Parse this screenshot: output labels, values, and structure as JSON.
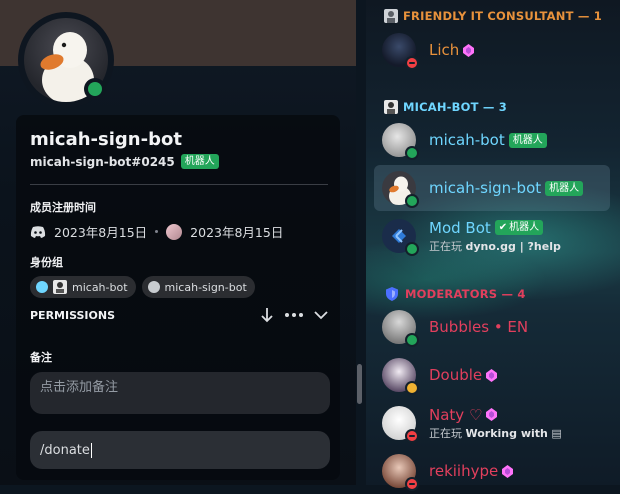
{
  "profile": {
    "display_name": "micah-sign-bot",
    "tag": "micah-sign-bot#0245",
    "bot_badge": "机器人",
    "member_since_title": "成员注册时间",
    "discord_joined": "2023年8月15日",
    "server_joined": "2023年8月15日",
    "roles_title": "身份组",
    "roles": [
      {
        "label": "micah-bot",
        "color": "#6fd6ff"
      },
      {
        "label": "micah-sign-bot",
        "color": "#c8ccd0"
      }
    ],
    "permissions_title": "PERMISSIONS",
    "note_title": "备注",
    "note_placeholder": "点击添加备注",
    "message_value": "/donate"
  },
  "member_list": {
    "groups": [
      {
        "title": "FRIENDLY IT CONSULTANT — 1",
        "color": "#e8923c",
        "members": [
          {
            "name": "Lich",
            "name_color": "#e8923c",
            "status": "dnd",
            "boost": true
          }
        ]
      },
      {
        "title": "MICAH-BOT — 3",
        "color": "#6fd6ff",
        "members": [
          {
            "name": "micah-bot",
            "name_color": "#6fd6ff",
            "status": "online",
            "badge": "机器人"
          },
          {
            "name": "micah-sign-bot",
            "name_color": "#6fd6ff",
            "status": "online",
            "badge": "机器人",
            "selected": true
          },
          {
            "name": "Mod Bot",
            "name_color": "#6fd6ff",
            "status": "online",
            "badge": "机器人",
            "verified": true,
            "activity_prefix": "正在玩",
            "activity": "dyno.gg | ?help"
          }
        ]
      },
      {
        "title": "MODERATORS — 4",
        "color": "#e23f5d",
        "members": [
          {
            "name": "Bubbles • EN",
            "name_color": "#e23f5d",
            "status": "online"
          },
          {
            "name": "Double",
            "name_color": "#e23f5d",
            "status": "idle",
            "boost": true
          },
          {
            "name": "Naty ♡",
            "name_color": "#e23f5d",
            "status": "dnd",
            "boost": true,
            "activity_prefix": "正在玩",
            "activity": "Working with"
          },
          {
            "name": "rekiihype",
            "name_color": "#e23f5d",
            "status": "dnd",
            "boost": true
          }
        ]
      }
    ]
  }
}
